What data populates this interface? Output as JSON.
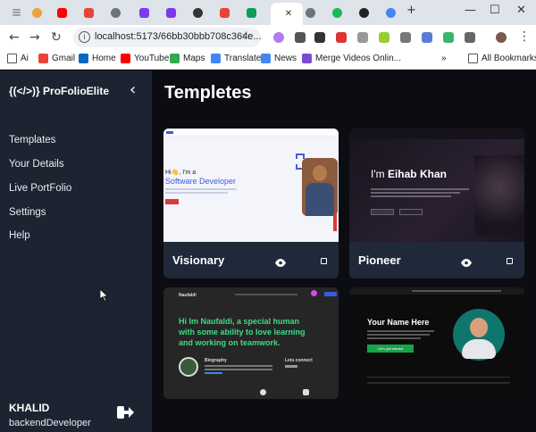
{
  "browser": {
    "url": "localhost:5173/66bb30bbb708c364e...",
    "bookmarks": [
      {
        "label": "Ai",
        "color": "#ffffff"
      },
      {
        "label": "Gmail",
        "color": "#ea4335"
      },
      {
        "label": "Home",
        "color": "#0a66c2"
      },
      {
        "label": "YouTube",
        "color": "#ff0000"
      },
      {
        "label": "Maps",
        "color": "#34a853"
      },
      {
        "label": "Translate",
        "color": "#4285f4"
      },
      {
        "label": "News",
        "color": "#4285f4"
      },
      {
        "label": "Merge Videos Onlin...",
        "color": "#7b4ccf"
      }
    ],
    "more_label": "»",
    "all_bookmarks": "All Bookmarks"
  },
  "sidebar": {
    "brand": "{(</>)} ProFolioElite",
    "nav": [
      "Templates",
      "Your Details",
      "Live PortFolio",
      "Settings",
      "Help"
    ],
    "user_name": "KHALID",
    "user_role": "backendDeveloper"
  },
  "main": {
    "title": "Templetes",
    "cards": [
      {
        "name": "Visionary",
        "preview": {
          "greeting": "Hi",
          "line1": ", I'm a",
          "role": "Software Developer"
        }
      },
      {
        "name": "Pioneer",
        "preview": {
          "intro": "I'm",
          "name": "Eihab Khan"
        }
      },
      {
        "name": "",
        "preview": {
          "brand": "Naufaldi",
          "headline1": "Hi Im Naufaldi, a special human",
          "headline2": "with some ability to love learning",
          "headline3": "and working on teamwork.",
          "bio_label": "Biography",
          "connect_label": "Lets connect"
        }
      },
      {
        "name": "",
        "preview": {
          "headline": "Your Name Here",
          "button": "Let's get started"
        }
      }
    ]
  },
  "colors": {
    "sidebar_bg": "#1c2431",
    "main_bg": "#0b0d12",
    "card_bg": "#20293a",
    "accent_green": "#3ddc84",
    "accent_blue": "#3b5bdb"
  }
}
